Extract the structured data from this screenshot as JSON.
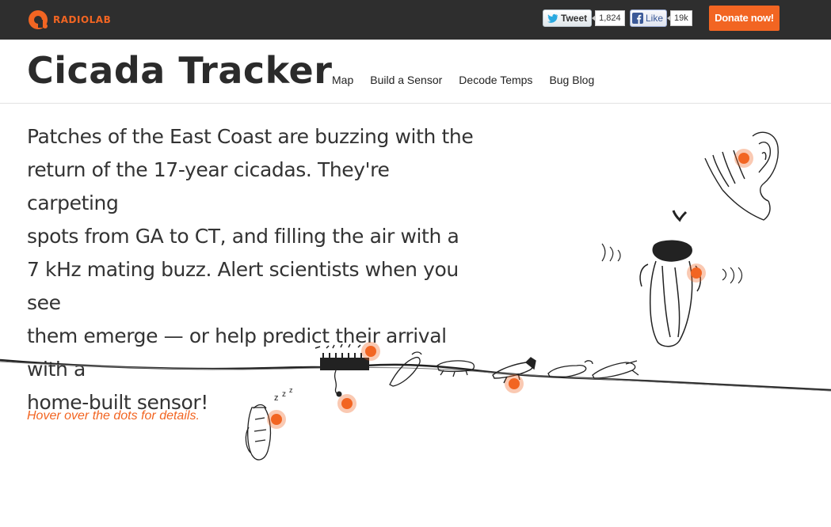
{
  "brand": {
    "logo_text": "RADIOLAB",
    "accent": "#f26522"
  },
  "share": {
    "tweet_label": "Tweet",
    "tweet_count": "1,824",
    "like_label": "Like",
    "like_count": "19k"
  },
  "donate_label": "Donate now!",
  "header": {
    "title": "Cicada Tracker",
    "nav": [
      "Map",
      "Build a Sensor",
      "Decode Temps",
      "Bug Blog"
    ]
  },
  "intro": {
    "lines": [
      "Patches of the East Coast are buzzing with the",
      "return of the 17-year cicadas. They're carpeting",
      "spots from GA to CT, and filling the air with a",
      "7 kHz mating buzz. Alert scientists when you see",
      "them emerge — or help predict their arrival with a",
      "home-built sensor!"
    ]
  },
  "hint": "Hover over the dots for details.",
  "icons": [
    "radiolab-logo-icon",
    "twitter-bird-icon",
    "facebook-f-icon"
  ]
}
